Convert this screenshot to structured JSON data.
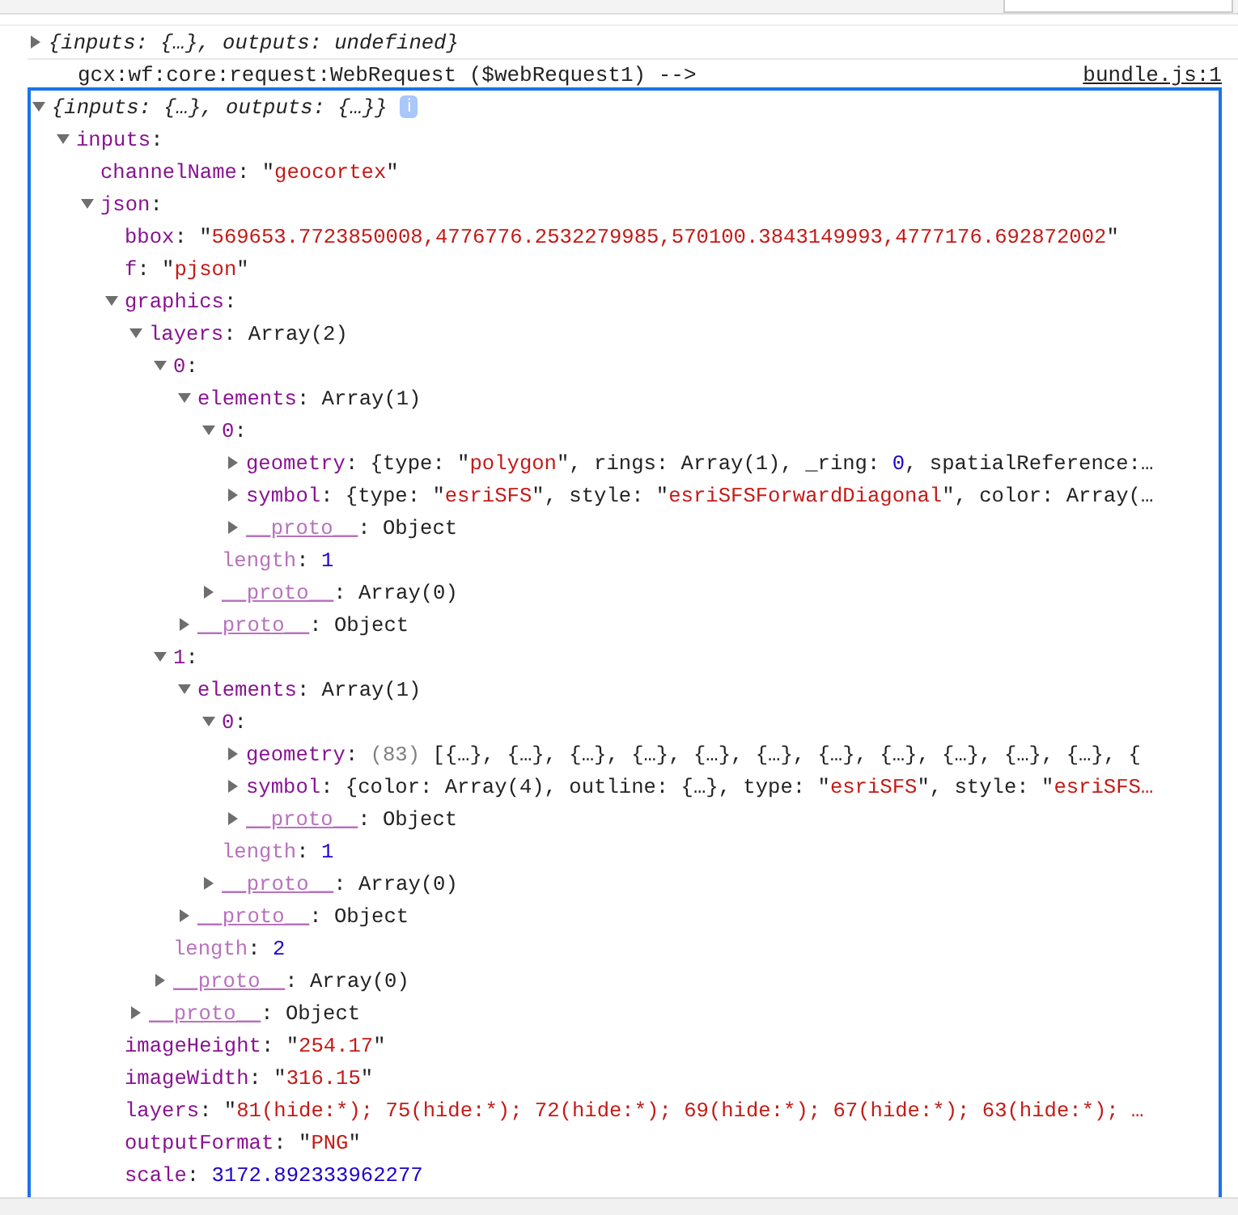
{
  "log": [
    {
      "kind": "object",
      "selected": false,
      "expanded": false,
      "segments": [
        {
          "kind": "italic",
          "text": "{inputs: {…}, outputs: undefined}"
        }
      ]
    },
    {
      "kind": "message",
      "text": "gcx:wf:core:request:WebRequest ($webRequest1) -->",
      "source": "bundle.js:1"
    },
    {
      "kind": "object",
      "selected": true,
      "expanded": true,
      "badge": "i",
      "segments": [
        {
          "kind": "italic",
          "text": "{inputs: {…}, outputs: {…}}"
        }
      ],
      "children": [
        {
          "expanded": true,
          "segments": [
            {
              "kind": "key",
              "text": "inputs"
            },
            {
              "kind": "plain",
              "text": ":"
            }
          ],
          "children": [
            {
              "segments": [
                {
                  "kind": "key",
                  "text": "channelName"
                },
                {
                  "kind": "plain",
                  "text": ": \""
                },
                {
                  "kind": "string",
                  "text": "geocortex"
                },
                {
                  "kind": "plain",
                  "text": "\""
                }
              ]
            },
            {
              "expanded": true,
              "segments": [
                {
                  "kind": "key",
                  "text": "json"
                },
                {
                  "kind": "plain",
                  "text": ":"
                }
              ],
              "children": [
                {
                  "segments": [
                    {
                      "kind": "key",
                      "text": "bbox"
                    },
                    {
                      "kind": "plain",
                      "text": ": \""
                    },
                    {
                      "kind": "string",
                      "text": "569653.7723850008,4776776.2532279985,570100.3843149993,4777176.692872002"
                    },
                    {
                      "kind": "plain",
                      "text": "\""
                    }
                  ]
                },
                {
                  "segments": [
                    {
                      "kind": "key",
                      "text": "f"
                    },
                    {
                      "kind": "plain",
                      "text": ": \""
                    },
                    {
                      "kind": "string",
                      "text": "pjson"
                    },
                    {
                      "kind": "plain",
                      "text": "\""
                    }
                  ]
                },
                {
                  "expanded": true,
                  "segments": [
                    {
                      "kind": "key",
                      "text": "graphics"
                    },
                    {
                      "kind": "plain",
                      "text": ":"
                    }
                  ],
                  "children": [
                    {
                      "expanded": true,
                      "segments": [
                        {
                          "kind": "key",
                          "text": "layers"
                        },
                        {
                          "kind": "plain",
                          "text": ": Array(2)"
                        }
                      ],
                      "children": [
                        {
                          "expanded": true,
                          "segments": [
                            {
                              "kind": "key",
                              "text": "0"
                            },
                            {
                              "kind": "plain",
                              "text": ":"
                            }
                          ],
                          "children": [
                            {
                              "expanded": true,
                              "segments": [
                                {
                                  "kind": "key",
                                  "text": "elements"
                                },
                                {
                                  "kind": "plain",
                                  "text": ": Array(1)"
                                }
                              ],
                              "children": [
                                {
                                  "expanded": true,
                                  "segments": [
                                    {
                                      "kind": "key",
                                      "text": "0"
                                    },
                                    {
                                      "kind": "plain",
                                      "text": ":"
                                    }
                                  ],
                                  "children": [
                                    {
                                      "expanded": false,
                                      "segments": [
                                        {
                                          "kind": "key",
                                          "text": "geometry"
                                        },
                                        {
                                          "kind": "plain",
                                          "text": ": {type: \""
                                        },
                                        {
                                          "kind": "string",
                                          "text": "polygon"
                                        },
                                        {
                                          "kind": "plain",
                                          "text": "\", rings: Array(1), _ring: "
                                        },
                                        {
                                          "kind": "number",
                                          "text": "0"
                                        },
                                        {
                                          "kind": "plain",
                                          "text": ", spatialReference:…"
                                        }
                                      ]
                                    },
                                    {
                                      "expanded": false,
                                      "segments": [
                                        {
                                          "kind": "key",
                                          "text": "symbol"
                                        },
                                        {
                                          "kind": "plain",
                                          "text": ": {type: \""
                                        },
                                        {
                                          "kind": "string",
                                          "text": "esriSFS"
                                        },
                                        {
                                          "kind": "plain",
                                          "text": "\", style: \""
                                        },
                                        {
                                          "kind": "string",
                                          "text": "esriSFSForwardDiagonal"
                                        },
                                        {
                                          "kind": "plain",
                                          "text": "\", color: Array(…"
                                        }
                                      ]
                                    },
                                    {
                                      "expanded": false,
                                      "segments": [
                                        {
                                          "kind": "proto_key",
                                          "text": "__proto__"
                                        },
                                        {
                                          "kind": "plain",
                                          "text": ": Object"
                                        }
                                      ]
                                    }
                                  ]
                                },
                                {
                                  "segments": [
                                    {
                                      "kind": "meta_key",
                                      "text": "length"
                                    },
                                    {
                                      "kind": "plain",
                                      "text": ": "
                                    },
                                    {
                                      "kind": "number",
                                      "text": "1"
                                    }
                                  ]
                                },
                                {
                                  "expanded": false,
                                  "segments": [
                                    {
                                      "kind": "proto_key",
                                      "text": "__proto__"
                                    },
                                    {
                                      "kind": "plain",
                                      "text": ": Array(0)"
                                    }
                                  ]
                                }
                              ]
                            },
                            {
                              "expanded": false,
                              "segments": [
                                {
                                  "kind": "proto_key",
                                  "text": "__proto__"
                                },
                                {
                                  "kind": "plain",
                                  "text": ": Object"
                                }
                              ]
                            }
                          ]
                        },
                        {
                          "expanded": true,
                          "segments": [
                            {
                              "kind": "key",
                              "text": "1"
                            },
                            {
                              "kind": "plain",
                              "text": ":"
                            }
                          ],
                          "children": [
                            {
                              "expanded": true,
                              "segments": [
                                {
                                  "kind": "key",
                                  "text": "elements"
                                },
                                {
                                  "kind": "plain",
                                  "text": ": Array(1)"
                                }
                              ],
                              "children": [
                                {
                                  "expanded": true,
                                  "segments": [
                                    {
                                      "kind": "key",
                                      "text": "0"
                                    },
                                    {
                                      "kind": "plain",
                                      "text": ":"
                                    }
                                  ],
                                  "children": [
                                    {
                                      "expanded": false,
                                      "segments": [
                                        {
                                          "kind": "key",
                                          "text": "geometry"
                                        },
                                        {
                                          "kind": "plain",
                                          "text": ": "
                                        },
                                        {
                                          "kind": "dim",
                                          "text": "(83)"
                                        },
                                        {
                                          "kind": "plain",
                                          "text": " [{…}, {…}, {…}, {…}, {…}, {…}, {…}, {…}, {…}, {…}, {…}, {"
                                        }
                                      ]
                                    },
                                    {
                                      "expanded": false,
                                      "segments": [
                                        {
                                          "kind": "key",
                                          "text": "symbol"
                                        },
                                        {
                                          "kind": "plain",
                                          "text": ": {color: Array(4), outline: {…}, type: \""
                                        },
                                        {
                                          "kind": "string",
                                          "text": "esriSFS"
                                        },
                                        {
                                          "kind": "plain",
                                          "text": "\", style: \""
                                        },
                                        {
                                          "kind": "string",
                                          "text": "esriSFS…"
                                        }
                                      ]
                                    },
                                    {
                                      "expanded": false,
                                      "segments": [
                                        {
                                          "kind": "proto_key",
                                          "text": "__proto__"
                                        },
                                        {
                                          "kind": "plain",
                                          "text": ": Object"
                                        }
                                      ]
                                    }
                                  ]
                                },
                                {
                                  "segments": [
                                    {
                                      "kind": "meta_key",
                                      "text": "length"
                                    },
                                    {
                                      "kind": "plain",
                                      "text": ": "
                                    },
                                    {
                                      "kind": "number",
                                      "text": "1"
                                    }
                                  ]
                                },
                                {
                                  "expanded": false,
                                  "segments": [
                                    {
                                      "kind": "proto_key",
                                      "text": "__proto__"
                                    },
                                    {
                                      "kind": "plain",
                                      "text": ": Array(0)"
                                    }
                                  ]
                                }
                              ]
                            },
                            {
                              "expanded": false,
                              "segments": [
                                {
                                  "kind": "proto_key",
                                  "text": "__proto__"
                                },
                                {
                                  "kind": "plain",
                                  "text": ": Object"
                                }
                              ]
                            }
                          ]
                        },
                        {
                          "segments": [
                            {
                              "kind": "meta_key",
                              "text": "length"
                            },
                            {
                              "kind": "plain",
                              "text": ": "
                            },
                            {
                              "kind": "number",
                              "text": "2"
                            }
                          ]
                        },
                        {
                          "expanded": false,
                          "segments": [
                            {
                              "kind": "proto_key",
                              "text": "__proto__"
                            },
                            {
                              "kind": "plain",
                              "text": ": Array(0)"
                            }
                          ]
                        }
                      ]
                    },
                    {
                      "expanded": false,
                      "segments": [
                        {
                          "kind": "proto_key",
                          "text": "__proto__"
                        },
                        {
                          "kind": "plain",
                          "text": ": Object"
                        }
                      ]
                    }
                  ]
                },
                {
                  "segments": [
                    {
                      "kind": "key",
                      "text": "imageHeight"
                    },
                    {
                      "kind": "plain",
                      "text": ": \""
                    },
                    {
                      "kind": "string",
                      "text": "254.17"
                    },
                    {
                      "kind": "plain",
                      "text": "\""
                    }
                  ]
                },
                {
                  "segments": [
                    {
                      "kind": "key",
                      "text": "imageWidth"
                    },
                    {
                      "kind": "plain",
                      "text": ": \""
                    },
                    {
                      "kind": "string",
                      "text": "316.15"
                    },
                    {
                      "kind": "plain",
                      "text": "\""
                    }
                  ]
                },
                {
                  "segments": [
                    {
                      "kind": "key",
                      "text": "layers"
                    },
                    {
                      "kind": "plain",
                      "text": ": \""
                    },
                    {
                      "kind": "string",
                      "text": "81(hide:*); 75(hide:*); 72(hide:*); 69(hide:*); 67(hide:*); 63(hide:*); …"
                    }
                  ]
                },
                {
                  "segments": [
                    {
                      "kind": "key",
                      "text": "outputFormat"
                    },
                    {
                      "kind": "plain",
                      "text": ": \""
                    },
                    {
                      "kind": "string",
                      "text": "PNG"
                    },
                    {
                      "kind": "plain",
                      "text": "\""
                    }
                  ]
                },
                {
                  "segments": [
                    {
                      "kind": "key",
                      "text": "scale"
                    },
                    {
                      "kind": "plain",
                      "text": ": "
                    },
                    {
                      "kind": "number",
                      "text": "3172.892333962277"
                    }
                  ]
                }
              ]
            }
          ]
        }
      ]
    }
  ]
}
